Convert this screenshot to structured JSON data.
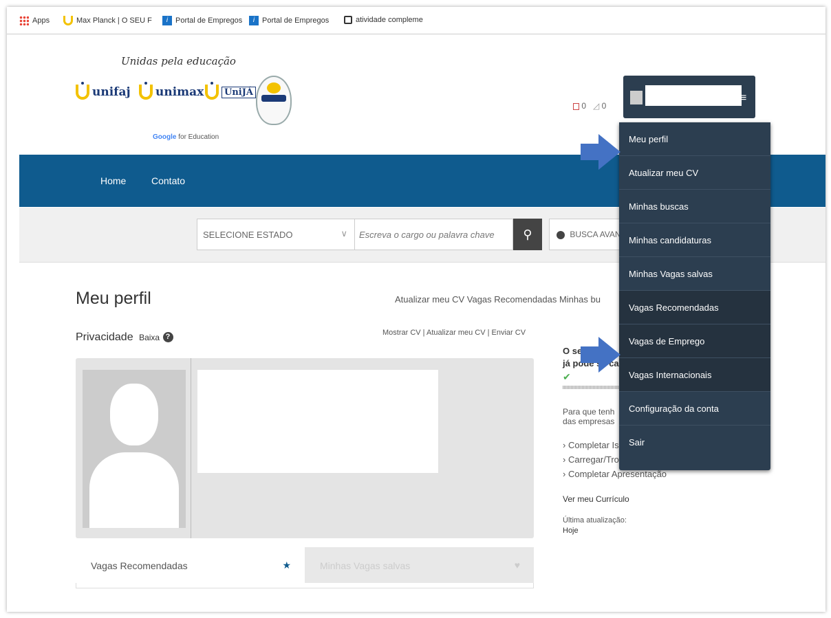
{
  "bookmarks": [
    {
      "label": "Apps",
      "icon": "apps-grid-icon"
    },
    {
      "label": "Max Planck | O SEU F",
      "icon": "unifaj-u-icon"
    },
    {
      "label": "Portal de Empregos",
      "icon": "portal-i-icon"
    },
    {
      "label": "Portal de Empregos",
      "icon": "portal-i-icon"
    },
    {
      "label": "atividade compleme",
      "icon": "document-icon"
    }
  ],
  "header": {
    "tagline": "Unidas pela educação",
    "logos": [
      "unifaj",
      "unimax",
      "UniJÁ"
    ],
    "google_google": "Google",
    "google_rest": "for Education",
    "count_a": "0",
    "count_b": "0"
  },
  "nav": {
    "home": "Home",
    "contato": "Contato"
  },
  "search": {
    "state": "SELECIONE ESTADO",
    "keyword_placeholder": "Escreva o cargo ou palavra chave",
    "advanced": "BUSCA AVAN"
  },
  "profile": {
    "title": "Meu perfil",
    "top_links": "Atualizar meu CV   Vagas Recomendadas   Minhas bu",
    "privacy_label": "Privacidade",
    "privacy_level": "Baixa",
    "cv_links": "Mostrar CV | Atualizar meu CV | Enviar CV"
  },
  "tabs": {
    "recommended": "Vagas Recomendadas",
    "saved": "Minhas Vagas salvas"
  },
  "side_panel": {
    "title_line1": "O se",
    "title_line2": "já pode se can",
    "para_line1": "Para que tenh",
    "para_line2": "das empresas",
    "links": [
      "Completar Is",
      "Carregar/Trocar Foto",
      "Completar Apresentação"
    ],
    "ver_cv": "Ver meu Currículo",
    "last_update_label": "Última atualização:",
    "last_update_value": "Hoje"
  },
  "menu": {
    "items": [
      "Meu perfil",
      "Atualizar meu CV",
      "Minhas buscas",
      "Minhas candidaturas",
      "Minhas Vagas salvas",
      "Vagas Recomendadas",
      "Vagas de Emprego",
      "Vagas Internacionais",
      "Configuração da conta",
      "Sair"
    ]
  },
  "colors": {
    "nav_blue": "#0f5b8e",
    "menu_bg": "#2c3e50",
    "arrow": "#4472c4",
    "logo_yellow": "#f3c200"
  }
}
